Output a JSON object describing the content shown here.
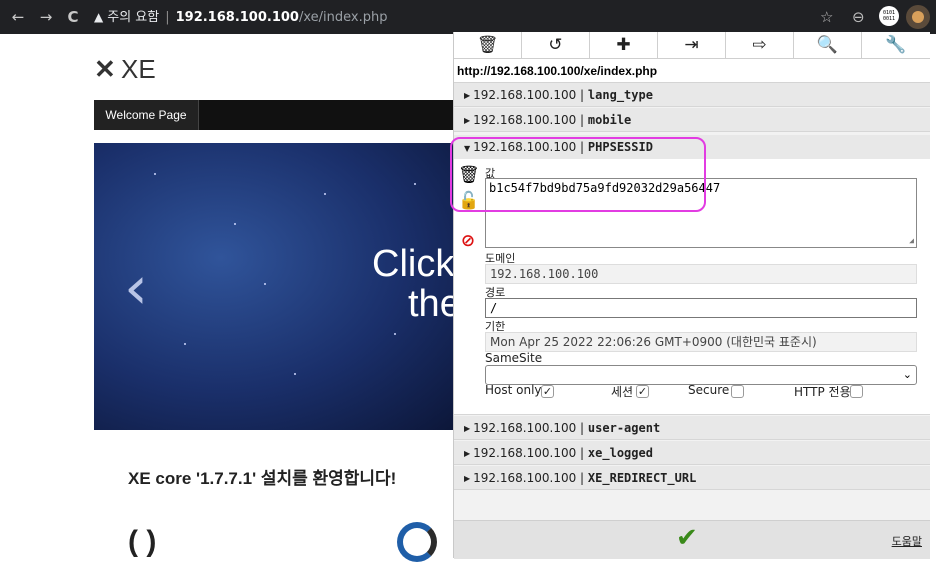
{
  "browser": {
    "back": "←",
    "forward": "→",
    "reload": "C",
    "warning_icon": "▲",
    "warning_text": "주의 요함",
    "url_host": "192.168.100.100",
    "url_path": "/xe/index.php",
    "star": "☆",
    "profile": "⊖",
    "ext_label": "0101 0011"
  },
  "page": {
    "logo_text": "XE",
    "nav_item": "Welcome Page",
    "hero_line1": "Click",
    "hero_line2": "the",
    "hero_arrow": "‹",
    "welcome_heading": "XE core '1.7.7.1' 설치를 환영합니다!",
    "bottom_icon_1": "( )"
  },
  "panel": {
    "toolbar": [
      {
        "icon": "trash-icon",
        "glyph": "🗑"
      },
      {
        "icon": "undo-icon",
        "glyph": "↺"
      },
      {
        "icon": "plus-icon",
        "glyph": "✚"
      },
      {
        "icon": "import-icon",
        "glyph": "⇥"
      },
      {
        "icon": "export-icon",
        "glyph": "⇨"
      },
      {
        "icon": "search-icon",
        "glyph": "🔍"
      },
      {
        "icon": "wrench-icon",
        "glyph": "🔧"
      }
    ],
    "url": "http://192.168.100.100/xe/index.php",
    "cookies_before": [
      {
        "domain": "192.168.100.100",
        "name": "lang_type"
      },
      {
        "domain": "192.168.100.100",
        "name": "mobile"
      }
    ],
    "expanded": {
      "domain": "192.168.100.100",
      "name": "PHPSESSID",
      "value_label": "값",
      "value": "b1c54f7bd9bd75a9fd92032d29a56447",
      "domain_label": "도메인",
      "domain_value": "192.168.100.100",
      "path_label": "경로",
      "path_value": "/",
      "expiry_label": "기한",
      "expiry_value": "Mon Apr 25 2022 22:06:26 GMT+0900 (대한민국 표준시)",
      "samesite_label": "SameSite",
      "samesite_value": "",
      "host_only_label": "Host only",
      "host_only": true,
      "session_label": "세션",
      "session": true,
      "secure_label": "Secure",
      "secure": false,
      "http_only_label": "HTTP 전용",
      "http_only": false
    },
    "cookies_after": [
      {
        "domain": "192.168.100.100",
        "name": "user-agent"
      },
      {
        "domain": "192.168.100.100",
        "name": "xe_logged"
      },
      {
        "domain": "192.168.100.100",
        "name": "XE_REDIRECT_URL"
      }
    ],
    "separator": "|",
    "help_link": "도움말",
    "highlight_color": "#e23ce2",
    "ok_color": "#3a8a1a"
  }
}
